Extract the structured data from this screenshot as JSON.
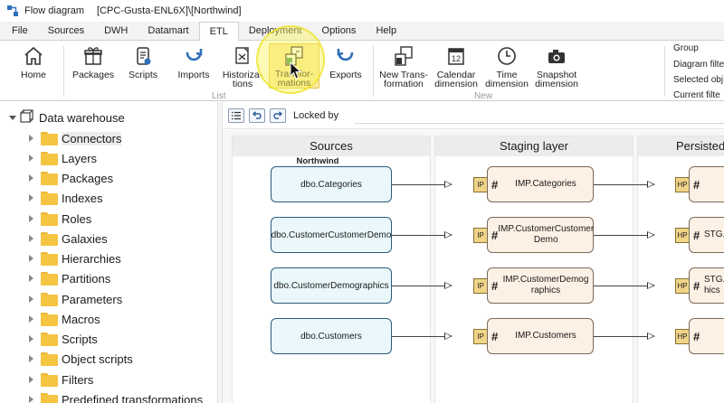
{
  "window": {
    "title": "Flow diagram",
    "path": "[CPC-Gusta-ENL6X]\\[Northwind]"
  },
  "menu": {
    "tabs": [
      "File",
      "Sources",
      "DWH",
      "Datamart",
      "ETL",
      "Deployment",
      "Options",
      "Help"
    ],
    "active": "ETL"
  },
  "ribbon": {
    "home": "Home",
    "packages": "Packages",
    "scripts": "Scripts",
    "imports": "Imports",
    "historizations": [
      "Historiza-",
      "tions"
    ],
    "transformations": [
      "Transfor-",
      "mations"
    ],
    "exports": "Exports",
    "new_transformation": [
      "New Trans-",
      "formation"
    ],
    "calendar_dimension": [
      "Calendar",
      "dimension"
    ],
    "time_dimension": [
      "Time",
      "dimension"
    ],
    "snapshot_dimension": [
      "Snapshot",
      "dimension"
    ],
    "group_list": "List",
    "group_new": "New",
    "right_items": [
      "Group",
      "Diagram filte",
      "Selected obj",
      "Current filte"
    ],
    "accent": "#f5d76e"
  },
  "tree": {
    "root": "Data warehouse",
    "items": [
      "Connectors",
      "Layers",
      "Packages",
      "Indexes",
      "Roles",
      "Galaxies",
      "Hierarchies",
      "Partitions",
      "Parameters",
      "Macros",
      "Scripts",
      "Object scripts",
      "Filters",
      "Predefined transformations"
    ],
    "selected": "Connectors",
    "folder_color": "#f5c542"
  },
  "toolbar": {
    "locked_by": "Locked by",
    "locked_value": ""
  },
  "diagram": {
    "lanes": [
      "Sources",
      "Staging layer",
      "Persisted"
    ],
    "source_group": "Northwind",
    "sources": [
      "dbo.Categories",
      "dbo.CustomerCustomerDemo",
      "dbo.CustomerDemographics",
      "dbo.Customers"
    ],
    "staging": [
      {
        "badge": "IP",
        "hash": "#",
        "name": "IMP.Categories"
      },
      {
        "badge": "IP",
        "hash": "#",
        "name": "IMP.CustomerCustomer Demo"
      },
      {
        "badge": "IP",
        "hash": "#",
        "name": "IMP.CustomerDemographics"
      },
      {
        "badge": "IP",
        "hash": "#",
        "name": "IMP.Customers"
      }
    ],
    "persisted": [
      {
        "badge": "HP",
        "hash": "#",
        "name": ""
      },
      {
        "badge": "HP",
        "hash": "#",
        "name": "STG."
      },
      {
        "badge": "HP",
        "hash": "#",
        "name": "STG. hics"
      },
      {
        "badge": "HP",
        "hash": "#",
        "name": ""
      }
    ]
  }
}
